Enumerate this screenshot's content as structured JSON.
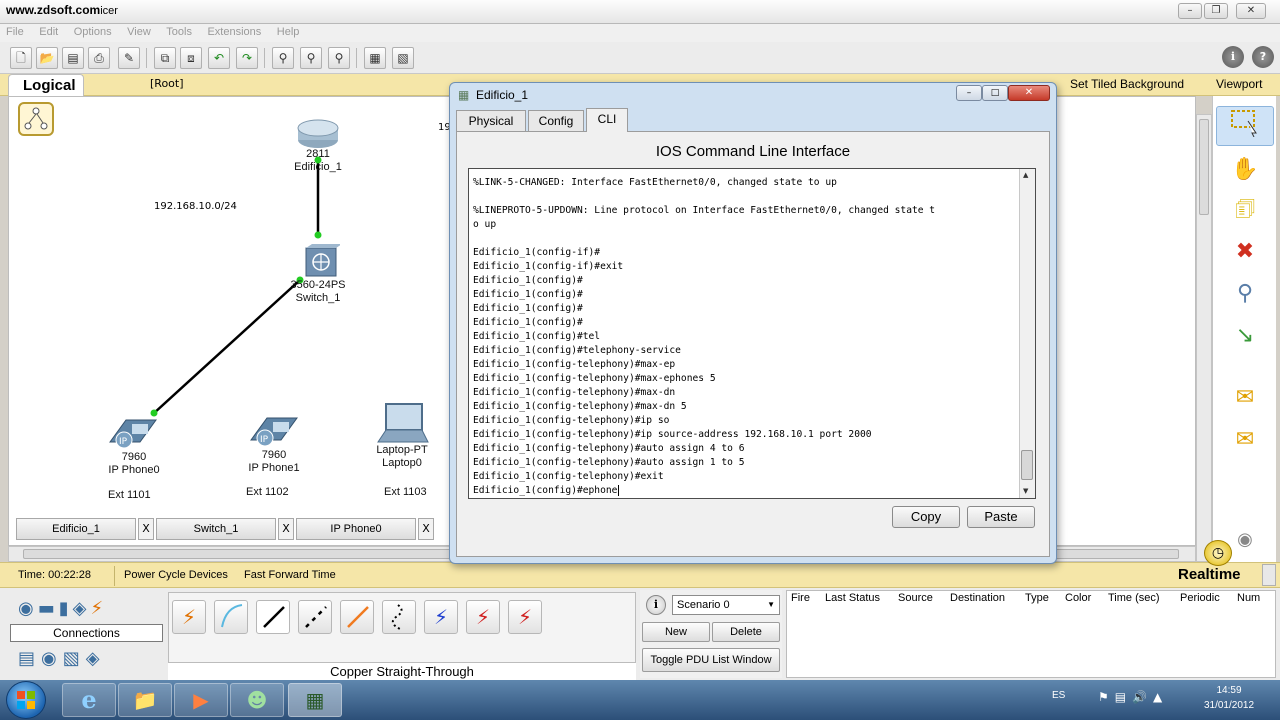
{
  "window": {
    "title": "www.zdsoft.com",
    "title_suffix": "icer"
  },
  "menu": [
    "File",
    "Edit",
    "Options",
    "View",
    "Tools",
    "Extensions",
    "Help"
  ],
  "logical_bar": {
    "tab": "Logical",
    "root": "[Root]",
    "tiled": "Set Tiled Background",
    "viewport": "Viewport"
  },
  "topology": {
    "router": {
      "model": "2811",
      "name": "Edificio_1"
    },
    "switch": {
      "model": "3560-24PS",
      "name": "Switch_1"
    },
    "network": "192.168.10.0/24",
    "stub": "19",
    "phone0": {
      "model": "7960",
      "name": "IP Phone0",
      "ext": "Ext 1101"
    },
    "phone1": {
      "model": "7960",
      "name": "IP Phone1",
      "ext": "Ext 1102"
    },
    "laptop": {
      "model": "Laptop-PT",
      "name": "Laptop0",
      "ext": "Ext 1103"
    }
  },
  "device_tabs": [
    "Edificio_1",
    "Switch_1",
    "IP Phone0"
  ],
  "device_tab_close": "X",
  "scroll_grip": "III",
  "status": {
    "time": "Time: 00:22:28",
    "power": "Power Cycle Devices",
    "fast_forward": "Fast Forward Time",
    "mode": "Realtime"
  },
  "connections": {
    "label": "Connections",
    "selected_cable": "Copper Straight-Through"
  },
  "scenario": {
    "info": "i",
    "selected": "Scenario 0",
    "new": "New",
    "delete": "Delete",
    "toggle": "Toggle PDU List Window"
  },
  "pdu_columns": [
    "Fire",
    "Last Status",
    "Source",
    "Destination",
    "Type",
    "Color",
    "Time (sec)",
    "Periodic",
    "Num"
  ],
  "dialog": {
    "title": "Edificio_1",
    "tabs": [
      "Physical",
      "Config",
      "CLI"
    ],
    "active_tab": "CLI",
    "heading": "IOS Command Line Interface",
    "cli_lines": [
      "%LINK-5-CHANGED: Interface FastEthernet0/0, changed state to up",
      "",
      "%LINEPROTO-5-UPDOWN: Line protocol on Interface FastEthernet0/0, changed state t",
      "o up",
      "",
      "Edificio_1(config-if)#",
      "Edificio_1(config-if)#exit",
      "Edificio_1(config)#",
      "Edificio_1(config)#",
      "Edificio_1(config)#",
      "Edificio_1(config)#",
      "Edificio_1(config)#tel",
      "Edificio_1(config)#telephony-service",
      "Edificio_1(config-telephony)#max-ep",
      "Edificio_1(config-telephony)#max-ephones 5",
      "Edificio_1(config-telephony)#max-dn",
      "Edificio_1(config-telephony)#max-dn 5",
      "Edificio_1(config-telephony)#ip so",
      "Edificio_1(config-telephony)#ip source-address 192.168.10.1 port 2000",
      "Edificio_1(config-telephony)#auto assign 4 to 6",
      "Edificio_1(config-telephony)#auto assign 1 to 5",
      "Edificio_1(config-telephony)#exit",
      "Edificio_1(config)#ephone"
    ],
    "copy": "Copy",
    "paste": "Paste"
  },
  "tray": {
    "lang": "ES",
    "time": "14:59",
    "date": "31/01/2012"
  },
  "colors": {
    "accent_yellow": "#f5e6a8",
    "link_green": "#22cc22",
    "taskbar": "#2c4f78"
  }
}
